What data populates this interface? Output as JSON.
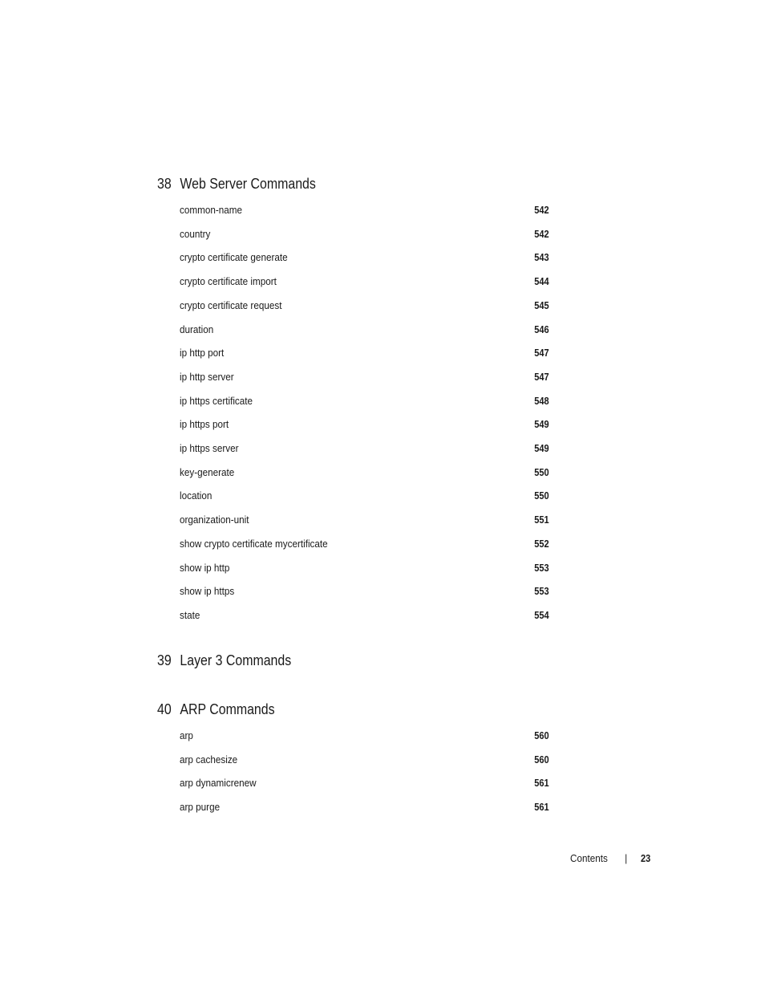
{
  "sections": [
    {
      "number": "38",
      "title": "Web Server Commands",
      "entries": [
        {
          "label": "common-name",
          "page": "542"
        },
        {
          "label": "country",
          "page": "542"
        },
        {
          "label": "crypto certificate generate",
          "page": "543"
        },
        {
          "label": "crypto certificate import",
          "page": "544"
        },
        {
          "label": "crypto certificate request",
          "page": "545"
        },
        {
          "label": "duration",
          "page": "546"
        },
        {
          "label": "ip http port",
          "page": "547"
        },
        {
          "label": "ip http server",
          "page": "547"
        },
        {
          "label": "ip https certificate",
          "page": "548"
        },
        {
          "label": "ip https port",
          "page": "549"
        },
        {
          "label": "ip https server",
          "page": "549"
        },
        {
          "label": "key-generate",
          "page": "550"
        },
        {
          "label": "location",
          "page": "550"
        },
        {
          "label": "organization-unit",
          "page": "551"
        },
        {
          "label": "show crypto certificate mycertificate",
          "page": "552"
        },
        {
          "label": "show ip http",
          "page": "553"
        },
        {
          "label": "show ip https",
          "page": "553"
        },
        {
          "label": "state",
          "page": "554"
        }
      ]
    },
    {
      "number": "39",
      "title": "Layer 3 Commands",
      "entries": []
    },
    {
      "number": "40",
      "title": "ARP Commands",
      "entries": [
        {
          "label": "arp",
          "page": "560"
        },
        {
          "label": "arp cachesize",
          "page": "560"
        },
        {
          "label": "arp dynamicrenew",
          "page": "561"
        },
        {
          "label": "arp purge",
          "page": "561"
        }
      ]
    }
  ],
  "footer": {
    "label": "Contents",
    "separator": "|",
    "page_number": "23"
  }
}
